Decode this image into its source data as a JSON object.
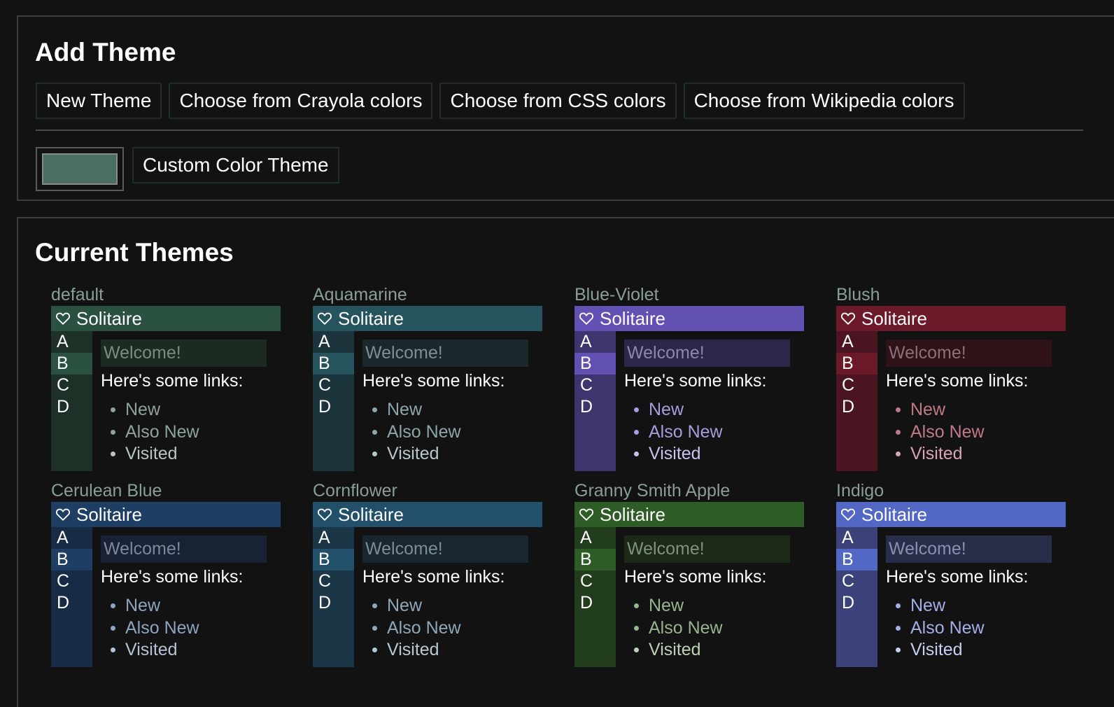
{
  "add_theme": {
    "title": "Add Theme",
    "buttons": [
      "New Theme",
      "Choose from Crayola colors",
      "Choose from CSS colors",
      "Choose from Wikipedia colors"
    ],
    "swatch_color": "#4a6f62",
    "custom_label": "Custom Color Theme"
  },
  "current_themes": {
    "title": "Current Themes",
    "preview": {
      "app_name": "Solitaire",
      "heart_icon": "heart-outline-icon",
      "sidebar_items": [
        "A",
        "B",
        "C",
        "D"
      ],
      "welcome": "Welcome!",
      "links_title": "Here's some links:",
      "links": [
        "New",
        "Also New",
        "Visited"
      ]
    },
    "themes": [
      {
        "name": "default",
        "bar": "#2b5140",
        "side": "#1d3127",
        "selected": "#2b5140",
        "welcome_bg": "#1c2a22",
        "welcome_text": "#7a8c82",
        "link": "#8fa398",
        "visited": "#b8c6bd"
      },
      {
        "name": "Aquamarine",
        "bar": "#25535e",
        "side": "#1c343b",
        "selected": "#25535e",
        "welcome_bg": "#1a282c",
        "welcome_text": "#7c8f94",
        "link": "#8ea5ab",
        "visited": "#b7c7cb"
      },
      {
        "name": "Blue-Violet",
        "bar": "#6251b2",
        "side": "#3e356f",
        "selected": "#6251b2",
        "welcome_bg": "#2c2748",
        "welcome_text": "#8d86ad",
        "link": "#a79cde",
        "visited": "#c9c1ee"
      },
      {
        "name": "Blush",
        "bar": "#6c1a2a",
        "side": "#4a1520",
        "selected": "#6c1a2a",
        "welcome_bg": "#2e1217",
        "welcome_text": "#8f6f75",
        "link": "#c07a87",
        "visited": "#d9a5ae"
      },
      {
        "name": "Cerulean Blue",
        "bar": "#1e3e63",
        "side": "#172b45",
        "selected": "#1e3e63",
        "welcome_bg": "#182233",
        "welcome_text": "#7c8899",
        "link": "#8ea4c0",
        "visited": "#b6c3d6"
      },
      {
        "name": "Cornflower",
        "bar": "#22506a",
        "side": "#1b3646",
        "selected": "#22506a",
        "welcome_bg": "#18262f",
        "welcome_text": "#7b8d98",
        "link": "#8ea8ba",
        "visited": "#b8c8d2"
      },
      {
        "name": "Granny Smith Apple",
        "bar": "#2e5c26",
        "side": "#213d1c",
        "selected": "#2e5c26",
        "welcome_bg": "#1c2919",
        "welcome_text": "#7f927a",
        "link": "#97b48f",
        "visited": "#bdd1b7"
      },
      {
        "name": "Indigo",
        "bar": "#5367c4",
        "side": "#3a4279",
        "selected": "#5367c4",
        "welcome_bg": "#2a2d4a",
        "welcome_text": "#8a8fb0",
        "link": "#a4aee8",
        "visited": "#c8cdf2"
      }
    ]
  }
}
